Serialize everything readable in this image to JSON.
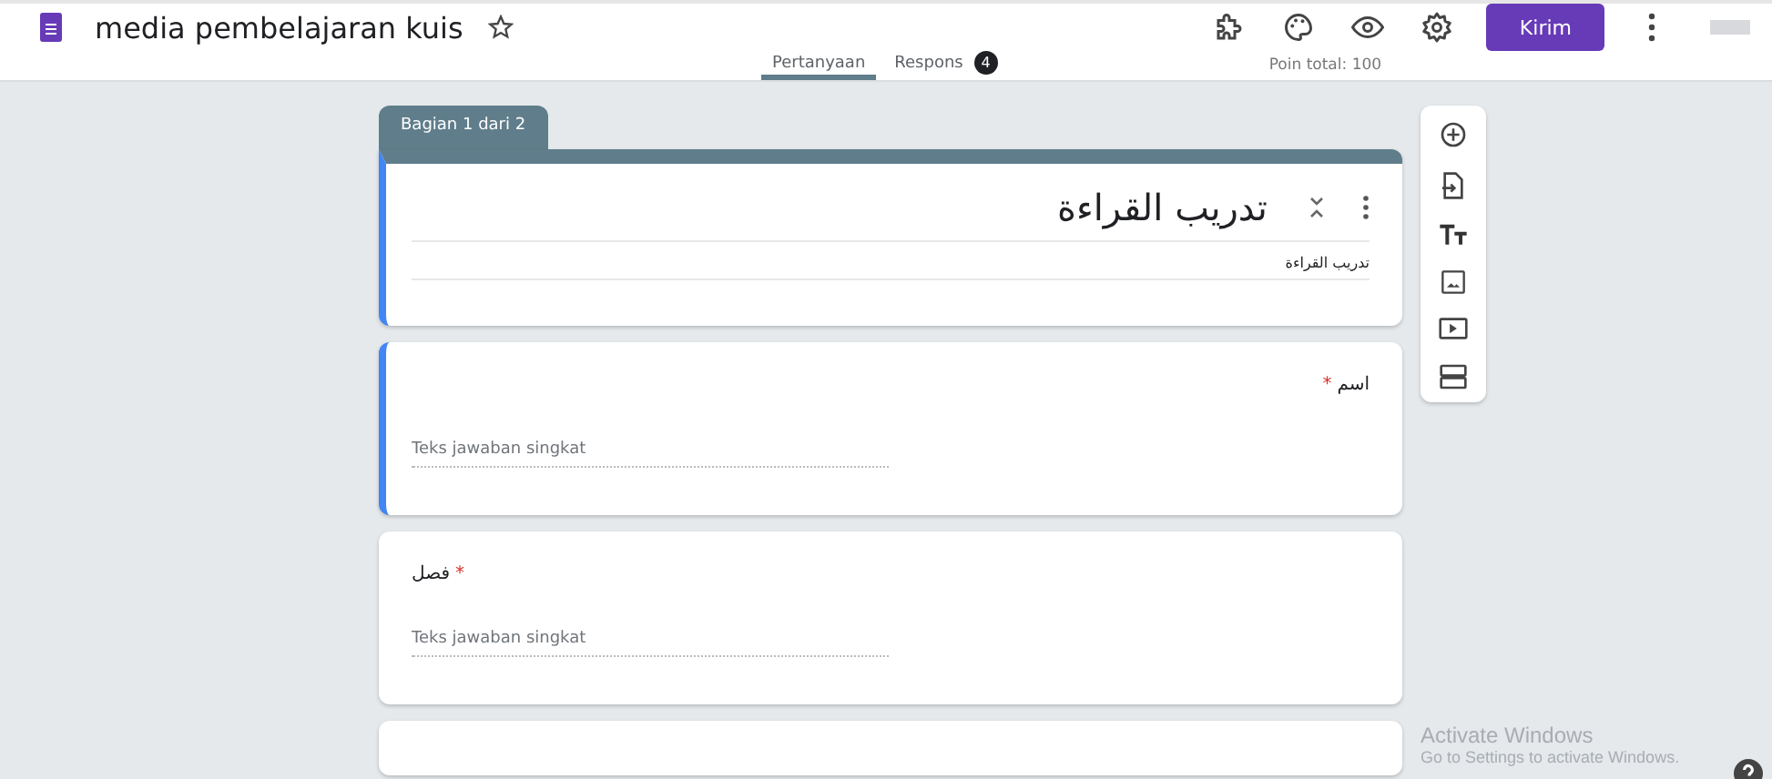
{
  "header": {
    "title": "media pembelajaran kuis",
    "send_button": "Kirim"
  },
  "tabs": [
    {
      "label": "Pertanyaan",
      "selected": true
    },
    {
      "label": "Respons",
      "selected": false,
      "badge": "4"
    }
  ],
  "points": "Poin total: 100",
  "section_tab": "Bagian 1 dari 2",
  "title_card": {
    "title": "تدريب القراءة",
    "description": "تدريب القراءة",
    "selected": true
  },
  "questions": [
    {
      "label": "اسم",
      "required_mark": "*",
      "kind": "rtl",
      "placeholder": "Teks jawaban singkat",
      "selected": true
    },
    {
      "label": "فصل",
      "required_mark": "*",
      "kind": "ltr",
      "placeholder": "Teks jawaban singkat",
      "selected": false
    }
  ],
  "windows_notice": {
    "title": "Activate Windows",
    "subtitle": "Go to Settings to activate Windows."
  }
}
